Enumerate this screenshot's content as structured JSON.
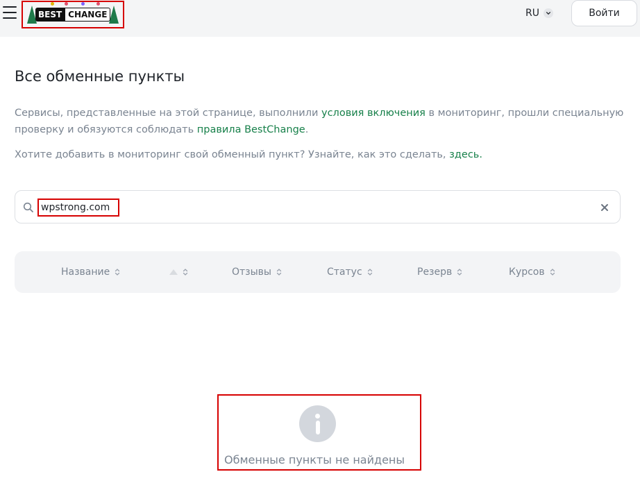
{
  "header": {
    "logo": {
      "best": "BEST",
      "change": "CHANGE"
    },
    "language": "RU",
    "login_label": "Войти"
  },
  "colors": {
    "accent_link": "#17804a",
    "highlight": "#d60000",
    "muted_text": "#7a8491"
  },
  "page": {
    "title": "Все обменные пункты",
    "desc1_before": "Сервисы, представленные на этой странице, выполнили ",
    "desc1_link1": "условия включения",
    "desc1_mid": " в мониторинг, прошли специальную проверку и обязуются соблюдать ",
    "desc1_link2": "правила BestChange",
    "desc1_after": ".",
    "desc2_before": "Хотите добавить в мониторинг свой обменный пункт? Узнайте, как это сделать, ",
    "desc2_link": "здесь."
  },
  "search": {
    "value": "wpstrong.com",
    "icon": "search-icon",
    "clear_icon": "close-icon"
  },
  "table": {
    "columns": [
      {
        "label": "Название"
      },
      {
        "label": ""
      },
      {
        "label": "Отзывы"
      },
      {
        "label": "Статус"
      },
      {
        "label": "Резерв"
      },
      {
        "label": "Курсов"
      }
    ]
  },
  "empty_state": {
    "icon": "info-icon",
    "message": "Обменные пункты не найдены"
  }
}
